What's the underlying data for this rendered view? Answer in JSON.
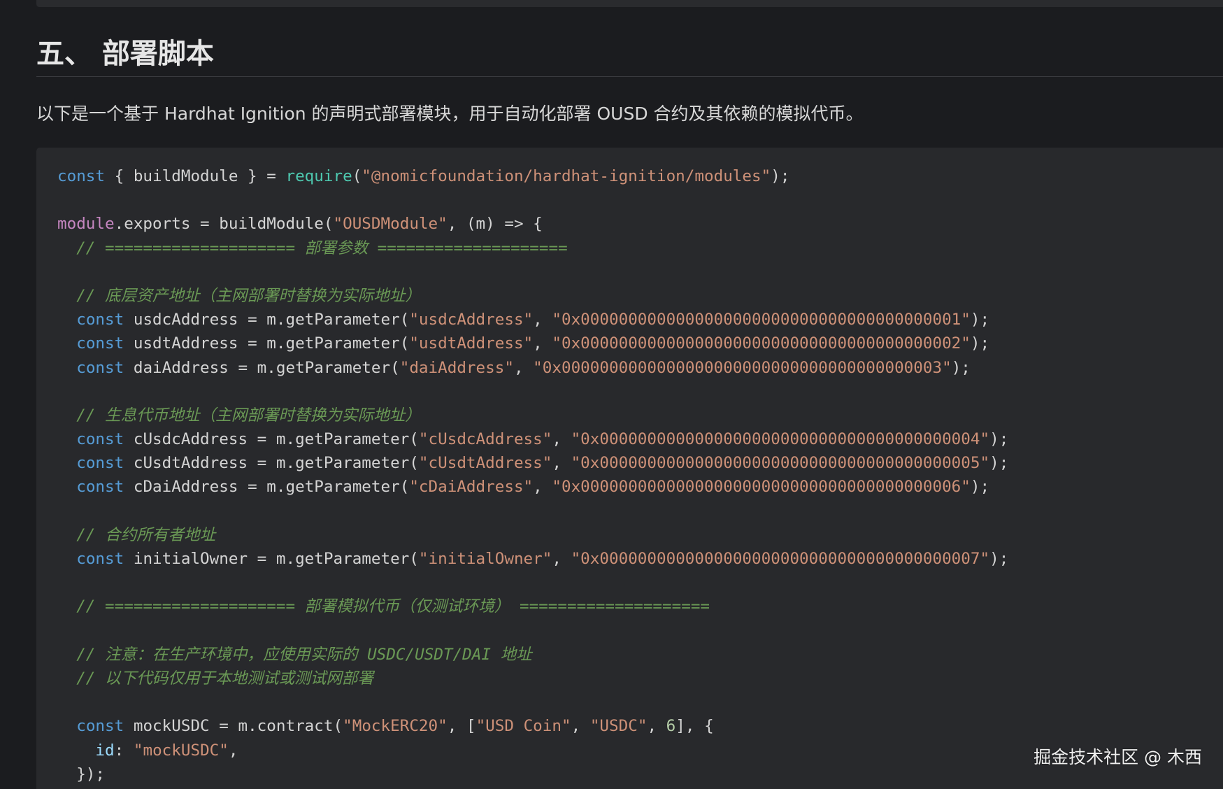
{
  "section": {
    "heading": "五、 部署脚本",
    "intro": "以下是一个基于 Hardhat Ignition 的声明式部署模块，用于自动化部署 OUSD 合约及其依赖的模拟代币。"
  },
  "code": {
    "language": "javascript",
    "lines": [
      [
        [
          "keyword",
          "const"
        ],
        [
          "plain",
          " { buildModule } = "
        ],
        [
          "builtin",
          "require"
        ],
        [
          "plain",
          "("
        ],
        [
          "string",
          "\"@nomicfoundation/hardhat-ignition/modules\""
        ],
        [
          "plain",
          ");"
        ]
      ],
      [],
      [
        [
          "module",
          "module"
        ],
        [
          "plain",
          ".exports = buildModule("
        ],
        [
          "string",
          "\"OUSDModule\""
        ],
        [
          "plain",
          ", (m) => {"
        ]
      ],
      [
        [
          "comment",
          "  // ==================== 部署参数 ===================="
        ]
      ],
      [],
      [
        [
          "comment",
          "  // 底层资产地址（主网部署时替换为实际地址）"
        ]
      ],
      [
        [
          "plain",
          "  "
        ],
        [
          "keyword",
          "const"
        ],
        [
          "plain",
          " usdcAddress = m.getParameter("
        ],
        [
          "string",
          "\"usdcAddress\""
        ],
        [
          "plain",
          ", "
        ],
        [
          "string",
          "\"0x0000000000000000000000000000000000000001\""
        ],
        [
          "plain",
          ");"
        ]
      ],
      [
        [
          "plain",
          "  "
        ],
        [
          "keyword",
          "const"
        ],
        [
          "plain",
          " usdtAddress = m.getParameter("
        ],
        [
          "string",
          "\"usdtAddress\""
        ],
        [
          "plain",
          ", "
        ],
        [
          "string",
          "\"0x0000000000000000000000000000000000000002\""
        ],
        [
          "plain",
          ");"
        ]
      ],
      [
        [
          "plain",
          "  "
        ],
        [
          "keyword",
          "const"
        ],
        [
          "plain",
          " daiAddress = m.getParameter("
        ],
        [
          "string",
          "\"daiAddress\""
        ],
        [
          "plain",
          ", "
        ],
        [
          "string",
          "\"0x0000000000000000000000000000000000000003\""
        ],
        [
          "plain",
          ");"
        ]
      ],
      [],
      [
        [
          "comment",
          "  // 生息代币地址（主网部署时替换为实际地址）"
        ]
      ],
      [
        [
          "plain",
          "  "
        ],
        [
          "keyword",
          "const"
        ],
        [
          "plain",
          " cUsdcAddress = m.getParameter("
        ],
        [
          "string",
          "\"cUsdcAddress\""
        ],
        [
          "plain",
          ", "
        ],
        [
          "string",
          "\"0x0000000000000000000000000000000000000004\""
        ],
        [
          "plain",
          ");"
        ]
      ],
      [
        [
          "plain",
          "  "
        ],
        [
          "keyword",
          "const"
        ],
        [
          "plain",
          " cUsdtAddress = m.getParameter("
        ],
        [
          "string",
          "\"cUsdtAddress\""
        ],
        [
          "plain",
          ", "
        ],
        [
          "string",
          "\"0x0000000000000000000000000000000000000005\""
        ],
        [
          "plain",
          ");"
        ]
      ],
      [
        [
          "plain",
          "  "
        ],
        [
          "keyword",
          "const"
        ],
        [
          "plain",
          " cDaiAddress = m.getParameter("
        ],
        [
          "string",
          "\"cDaiAddress\""
        ],
        [
          "plain",
          ", "
        ],
        [
          "string",
          "\"0x0000000000000000000000000000000000000006\""
        ],
        [
          "plain",
          ");"
        ]
      ],
      [],
      [
        [
          "comment",
          "  // 合约所有者地址"
        ]
      ],
      [
        [
          "plain",
          "  "
        ],
        [
          "keyword",
          "const"
        ],
        [
          "plain",
          " initialOwner = m.getParameter("
        ],
        [
          "string",
          "\"initialOwner\""
        ],
        [
          "plain",
          ", "
        ],
        [
          "string",
          "\"0x0000000000000000000000000000000000000007\""
        ],
        [
          "plain",
          ");"
        ]
      ],
      [],
      [
        [
          "comment",
          "  // ==================== 部署模拟代币（仅测试环境） ===================="
        ]
      ],
      [],
      [
        [
          "comment",
          "  // 注意：在生产环境中，应使用实际的 USDC/USDT/DAI 地址"
        ]
      ],
      [
        [
          "comment",
          "  // 以下代码仅用于本地测试或测试网部署"
        ]
      ],
      [],
      [
        [
          "plain",
          "  "
        ],
        [
          "keyword",
          "const"
        ],
        [
          "plain",
          " mockUSDC = m.contract("
        ],
        [
          "string",
          "\"MockERC20\""
        ],
        [
          "plain",
          ", ["
        ],
        [
          "string",
          "\"USD Coin\""
        ],
        [
          "plain",
          ", "
        ],
        [
          "string",
          "\"USDC\""
        ],
        [
          "plain",
          ", "
        ],
        [
          "number",
          "6"
        ],
        [
          "plain",
          "], {"
        ]
      ],
      [
        [
          "plain",
          "    "
        ],
        [
          "prop",
          "id"
        ],
        [
          "plain",
          ": "
        ],
        [
          "string",
          "\"mockUSDC\""
        ],
        [
          "plain",
          ","
        ]
      ],
      [
        [
          "plain",
          "  });"
        ]
      ]
    ]
  },
  "watermark": "掘金技术社区 @ 木西",
  "colors": {
    "background": "#1b1c1f",
    "code_background": "#28292c",
    "keyword": "#569cd6",
    "module": "#c586c0",
    "builtin": "#4ec9b0",
    "string": "#ce9178",
    "comment": "#6a9955",
    "number": "#b5cea8"
  }
}
